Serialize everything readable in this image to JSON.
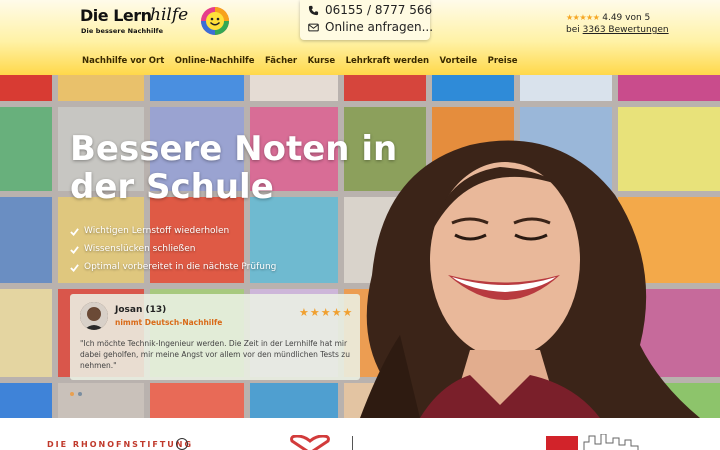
{
  "header": {
    "logo": {
      "main": "Die Lern",
      "script": "hilfe",
      "tagline": "Die bessere Nachhilfe"
    },
    "contact": {
      "phone": "06155 / 8777 566",
      "inquiry": "Online anfragen..."
    },
    "rating": {
      "stars_value": 4.49,
      "text": "4.49 von 5",
      "prefix": "bei",
      "reviews": "3363 Bewertungen"
    },
    "nav": [
      "Nachhilfe vor Ort",
      "Online-Nachhilfe",
      "Fächer",
      "Kurse",
      "Lehrkraft werden",
      "Vorteile",
      "Preise"
    ]
  },
  "hero": {
    "title": "Bessere Noten in der Schule",
    "bullets": [
      "Wichtigen Lernstoff wiederholen",
      "Wissenslücken schließen",
      "Optimal vorbereitet in die nächste Prüfung"
    ],
    "testimonial": {
      "name": "Josan (13)",
      "subject": "nimmt Deutsch-Nachhilfe",
      "stars": 5,
      "quote": "\"Ich möchte Technik-Ingenieur werden. Die Zeit in der Lernhilfe hat mir dabei geholfen, mir meine Angst vor allem vor den mündlichen Tests zu nehmen.\""
    },
    "slides": {
      "count": 2,
      "active": 1
    }
  },
  "press": {
    "label": "DIE RHONOFNSTIFTUNG"
  },
  "colors": {
    "accent": "#ffd84a",
    "orange": "#d96a18",
    "star": "#f5a623",
    "caritas_red": "#d2232a"
  }
}
